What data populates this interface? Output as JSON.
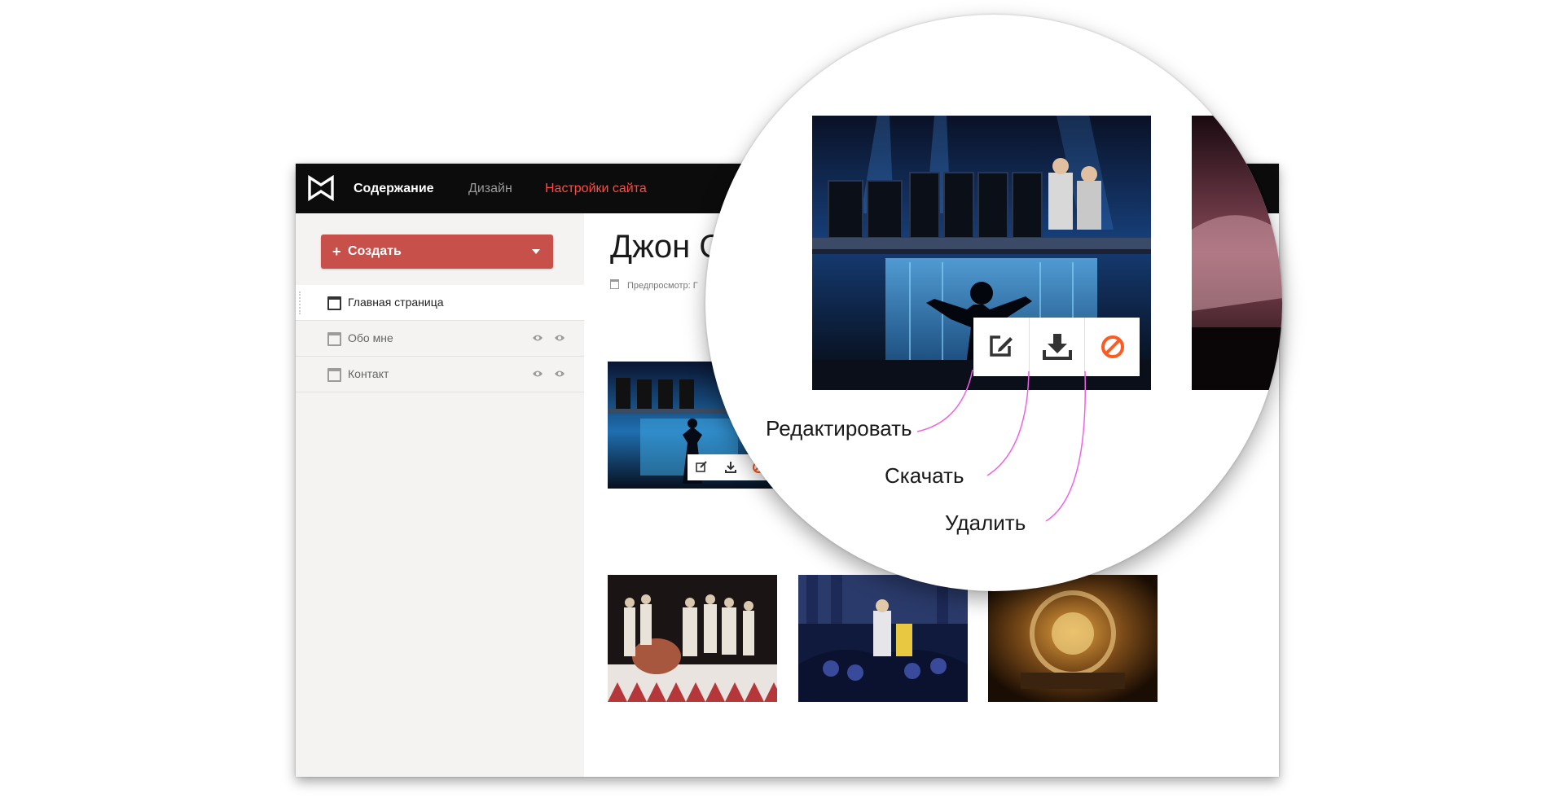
{
  "topbar": {
    "logo": "film-frame-logo",
    "nav": [
      {
        "label": "Содержание",
        "state": "active"
      },
      {
        "label": "Дизайн"
      },
      {
        "label": "Настройки сайта",
        "color": "#ff4a41"
      }
    ]
  },
  "sidebar": {
    "create_button": {
      "label": "Создать",
      "color": "#c8504b"
    },
    "pages": [
      {
        "label": "Главная страница",
        "active": true
      },
      {
        "label": "Обо мне",
        "icons": [
          "eye-icon",
          "eye-icon"
        ]
      },
      {
        "label": "Контакт",
        "icons": [
          "eye-icon",
          "eye-icon"
        ]
      }
    ]
  },
  "main": {
    "title": "Джон С",
    "preview_label": "Предпросмотр: Г"
  },
  "magnifier": {
    "toolbar": [
      {
        "icon": "edit-icon"
      },
      {
        "icon": "download-icon"
      },
      {
        "icon": "delete-icon",
        "color": "#ff5a1f"
      }
    ],
    "callouts": {
      "edit": "Редактировать",
      "download": "Скачать",
      "delete": "Удалить"
    },
    "callout_line_color": "#f060e8"
  }
}
